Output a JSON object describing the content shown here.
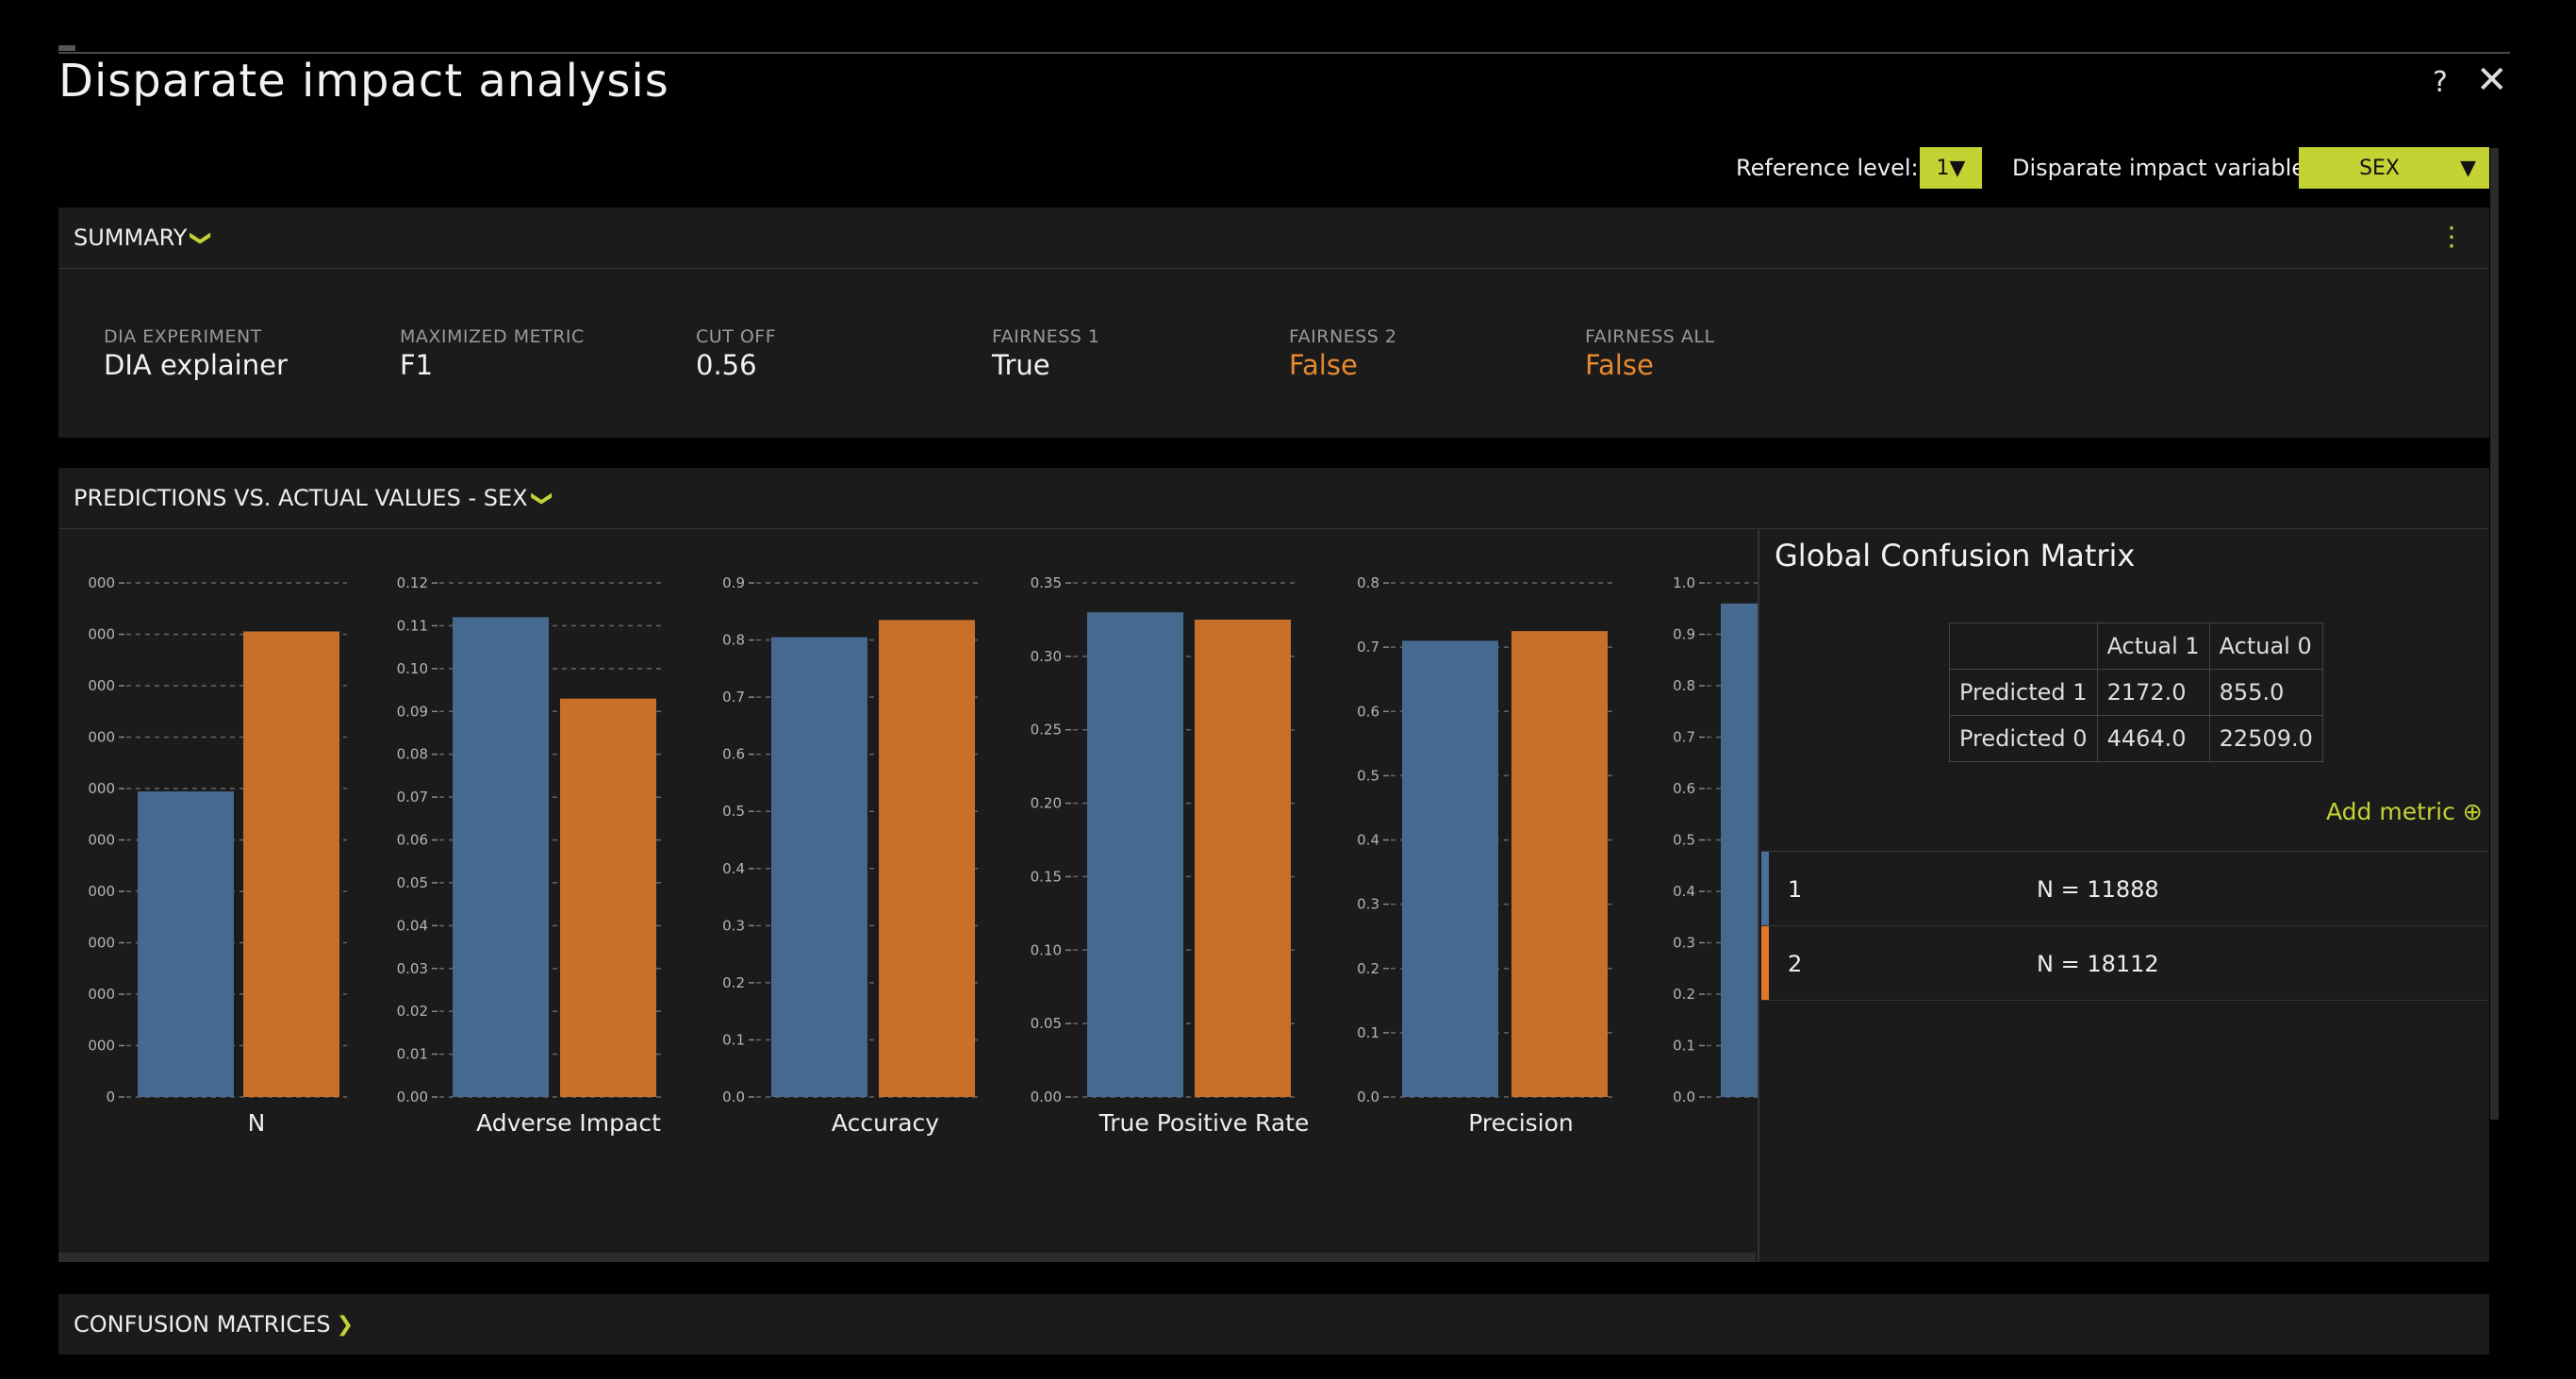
{
  "dialog": {
    "title": "Disparate impact analysis",
    "help": "?",
    "close": "✕"
  },
  "controls": {
    "reference_level_label": "Reference level:",
    "reference_level_value": "1",
    "variable_label": "Disparate impact variable:",
    "variable_value": "SEX"
  },
  "summary": {
    "title": "SUMMARY",
    "metrics": [
      {
        "label": "DIA EXPERIMENT",
        "value": "DIA explainer",
        "status": "normal"
      },
      {
        "label": "MAXIMIZED METRIC",
        "value": "F1",
        "status": "normal"
      },
      {
        "label": "CUT OFF",
        "value": "0.56",
        "status": "normal"
      },
      {
        "label": "FAIRNESS 1",
        "value": "True",
        "status": "normal"
      },
      {
        "label": "FAIRNESS 2",
        "value": "False",
        "status": "warn"
      },
      {
        "label": "FAIRNESS ALL",
        "value": "False",
        "status": "warn"
      }
    ]
  },
  "predictions": {
    "title": "PREDICTIONS VS. ACTUAL VALUES - SEX"
  },
  "confusion_matrices": {
    "title": "CONFUSION MATRICES"
  },
  "global_confusion_matrix": {
    "title": "Global Confusion Matrix",
    "headers": [
      "",
      "Actual 1",
      "Actual 0"
    ],
    "rows": [
      [
        "Predicted 1",
        "2172.0",
        "855.0"
      ],
      [
        "Predicted 0",
        "4464.0",
        "22509.0"
      ]
    ]
  },
  "add_metric": "Add metric ⊕",
  "legend": [
    {
      "level": "1",
      "n": "N = 11888",
      "color": "#4a6f9a"
    },
    {
      "level": "2",
      "n": "N = 18112",
      "color": "#e0762a"
    }
  ],
  "colors": {
    "accent": "#c4d333",
    "series1": "#46698f",
    "series2": "#c86f2a",
    "warn": "#e68a2e"
  },
  "chart_data": [
    {
      "type": "bar",
      "title": "",
      "xlabel": "N",
      "series_labels": [
        "1",
        "2"
      ],
      "values": [
        11888,
        18112
      ],
      "yticks": [
        "0",
        "000",
        "000",
        "000",
        "000",
        "000",
        "000",
        "000",
        "000",
        "000",
        "000"
      ],
      "ylim": [
        0,
        20000
      ]
    },
    {
      "type": "bar",
      "title": "",
      "xlabel": "Adverse Impact",
      "series_labels": [
        "1",
        "2"
      ],
      "values": [
        0.112,
        0.093
      ],
      "yticks": [
        "0.00",
        "0.01",
        "0.02",
        "0.03",
        "0.04",
        "0.05",
        "0.06",
        "0.07",
        "0.08",
        "0.09",
        "0.10",
        "0.11",
        "0.12"
      ],
      "ylim": [
        0,
        0.12
      ]
    },
    {
      "type": "bar",
      "title": "",
      "xlabel": "Accuracy",
      "series_labels": [
        "1",
        "2"
      ],
      "values": [
        0.805,
        0.835
      ],
      "yticks": [
        "0.0",
        "0.1",
        "0.2",
        "0.3",
        "0.4",
        "0.5",
        "0.6",
        "0.7",
        "0.8",
        "0.9"
      ],
      "ylim": [
        0,
        0.9
      ]
    },
    {
      "type": "bar",
      "title": "",
      "xlabel": "True Positive Rate",
      "series_labels": [
        "1",
        "2"
      ],
      "values": [
        0.33,
        0.325
      ],
      "yticks": [
        "0.00",
        "0.05",
        "0.10",
        "0.15",
        "0.20",
        "0.25",
        "0.30",
        "0.35"
      ],
      "ylim": [
        0,
        0.35
      ]
    },
    {
      "type": "bar",
      "title": "",
      "xlabel": "Precision",
      "series_labels": [
        "1",
        "2"
      ],
      "values": [
        0.71,
        0.725
      ],
      "yticks": [
        "0.0",
        "0.1",
        "0.2",
        "0.3",
        "0.4",
        "0.5",
        "0.6",
        "0.7",
        "0.8"
      ],
      "ylim": [
        0,
        0.8
      ]
    },
    {
      "type": "bar",
      "title": "",
      "xlabel": "",
      "series_labels": [
        "1",
        "2"
      ],
      "values": [
        0.96,
        null
      ],
      "yticks": [
        "0.0",
        "0.1",
        "0.2",
        "0.3",
        "0.4",
        "0.5",
        "0.6",
        "0.7",
        "0.8",
        "0.9",
        "1.0"
      ],
      "ylim": [
        0,
        1.0
      ]
    }
  ]
}
